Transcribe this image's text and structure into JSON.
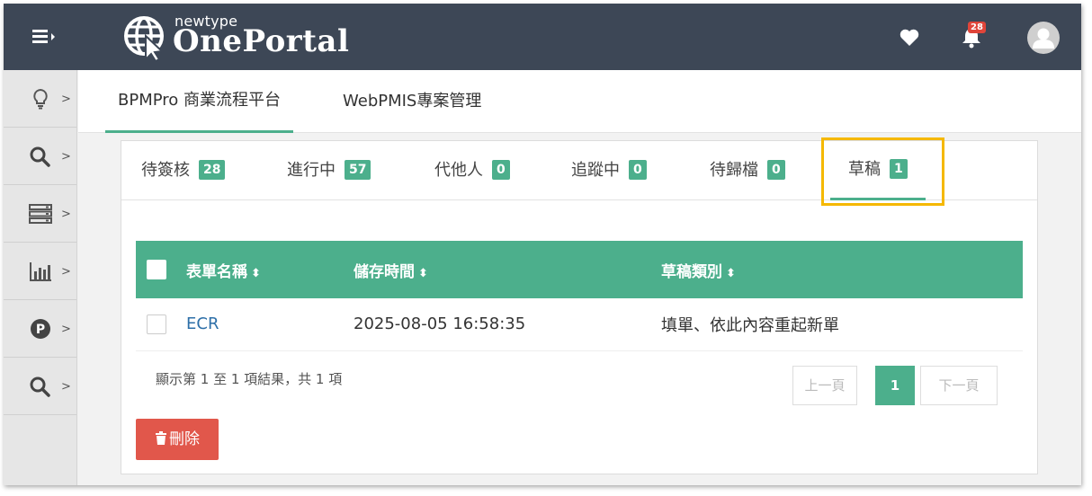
{
  "app": {
    "brand_small": "newtype",
    "brand_big": "OnePortal",
    "notification_count": "28"
  },
  "sidebar": {
    "items": [
      {
        "icon": "lightbulb-icon",
        "arrow": ">"
      },
      {
        "icon": "search-icon",
        "arrow": ">"
      },
      {
        "icon": "server-icon",
        "arrow": ">"
      },
      {
        "icon": "bar-chart-icon",
        "arrow": ">"
      },
      {
        "icon": "p-circle-icon",
        "arrow": ">"
      },
      {
        "icon": "search-icon",
        "arrow": ">"
      }
    ]
  },
  "main_tabs": [
    {
      "label": "BPMPro 商業流程平台",
      "active": true
    },
    {
      "label": "WebPMIS專案管理",
      "active": false
    }
  ],
  "subtabs": [
    {
      "label": "待簽核",
      "count": "28"
    },
    {
      "label": "進行中",
      "count": "57"
    },
    {
      "label": "代他人",
      "count": "0"
    },
    {
      "label": "追蹤中",
      "count": "0"
    },
    {
      "label": "待歸檔",
      "count": "0"
    },
    {
      "label": "草稿",
      "count": "1",
      "active": true
    }
  ],
  "table": {
    "headers": [
      "表單名稱",
      "儲存時間",
      "草稿類別"
    ],
    "sort_glyph": "⬍",
    "rows": [
      {
        "name": "ECR",
        "saved_time": "2025-08-05 16:58:35",
        "category": "填單、依此內容重起新單"
      }
    ]
  },
  "summary": "顯示第 1 至 1 項結果，共 1 項",
  "pagination": {
    "prev": "上一頁",
    "current": "1",
    "next": "下一頁"
  },
  "actions": {
    "delete_label": "刪除"
  },
  "colors": {
    "topbar": "#3d4756",
    "accent": "#4caf8c",
    "highlight": "#f5b800",
    "danger": "#e1574b",
    "link": "#2d6fa8"
  }
}
